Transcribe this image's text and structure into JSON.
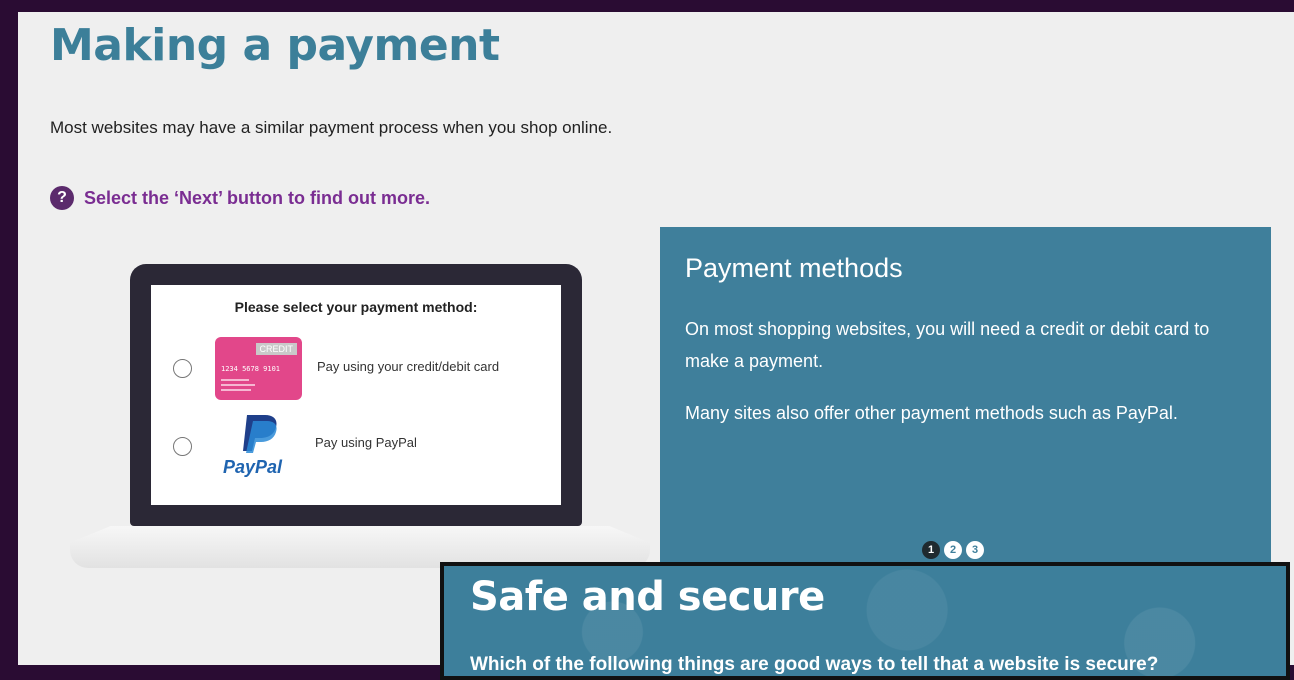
{
  "page": {
    "title": "Making a payment",
    "intro": "Most websites may have a similar payment process when you shop online.",
    "hint_icon": "?",
    "hint": "Select the ‘Next’ button to find out more."
  },
  "illustration": {
    "heading": "Please select your payment method:",
    "card_tag": "CREDIT",
    "card_number": "1234 5678 9101",
    "option_card_label": "Pay using your credit/debit card",
    "option_paypal_label": "Pay using PayPal",
    "paypal_logo_text": "PayPal"
  },
  "panel": {
    "title": "Payment methods",
    "paragraph1": "On most shopping websites, you will need a credit or debit card to make a payment.",
    "paragraph2": "Many sites also offer other payment methods such as PayPal.",
    "pages": [
      "1",
      "2",
      "3"
    ],
    "active_page": 1
  },
  "overlay": {
    "title": "Safe and secure",
    "question": "Which of the following things are good ways to tell that a website is secure?"
  },
  "colors": {
    "title": "#3c7f99",
    "panel": "#3f7f9b",
    "hint": "#7a2d92",
    "frame": "#2a0c33"
  }
}
